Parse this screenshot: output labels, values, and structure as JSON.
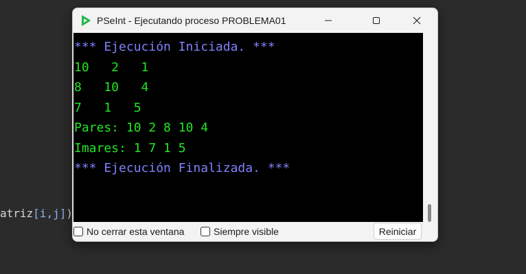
{
  "background": {
    "code_prefix": "atriz",
    "code_bracket": "[i,j]",
    "code_suffix": ")"
  },
  "window": {
    "title": "PSeInt - Ejecutando proceso PROBLEMA01",
    "icon": "pseint-app-icon",
    "controls": {
      "minimize": "minimize-icon",
      "maximize": "maximize-icon",
      "close": "close-icon"
    }
  },
  "console": {
    "lines": [
      {
        "text": "*** Ejecución Iniciada. ***",
        "color": "#8080ff"
      },
      {
        "text": "10   2   1",
        "color": "#22e622"
      },
      {
        "text": "8   10   4",
        "color": "#22e622"
      },
      {
        "text": "7   1   5",
        "color": "#22e622"
      },
      {
        "text": "Pares: 10 2 8 10 4",
        "color": "#22e622"
      },
      {
        "text": "Imares: 1 7 1 5",
        "color": "#22e622"
      },
      {
        "text": "*** Ejecución Finalizada. ***",
        "color": "#8080ff"
      }
    ]
  },
  "footer": {
    "keep_open_label": "No cerrar esta ventana",
    "always_visible_label": "Siempre visible",
    "restart_label": "Reiniciar"
  }
}
